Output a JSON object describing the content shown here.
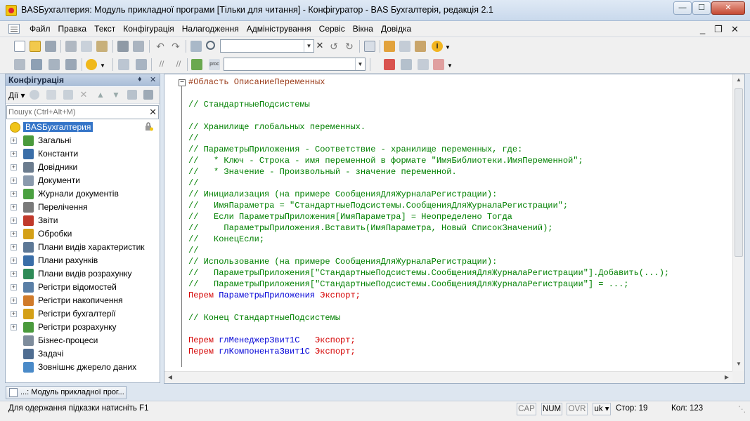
{
  "window": {
    "title": "BASБухгалтерия: Модуль прикладної програми [Тільки для читання] - Конфігуратор - BAS Бухгалтерія, редакція 2.1",
    "minimize_icon": "minimize-icon",
    "maximize_icon": "maximize-icon",
    "close_icon": "close-icon"
  },
  "menu": {
    "items": [
      "Файл",
      "Правка",
      "Текст",
      "Конфігурація",
      "Налагодження",
      "Адміністрування",
      "Сервіс",
      "Вікна",
      "Довідка"
    ]
  },
  "toolbar": {
    "search_value": "",
    "proc_value": ""
  },
  "left_panel": {
    "title": "Конфігурація",
    "actions_label": "Дії",
    "search_placeholder": "Пошук (Ctrl+Alt+M)",
    "root": "BASБухгалтерия",
    "items": [
      {
        "label": "Загальні",
        "icon": "common-icon",
        "color": "#4a9a3c",
        "expandable": true
      },
      {
        "label": "Константи",
        "icon": "constants-icon",
        "color": "#3a6ea8",
        "expandable": true
      },
      {
        "label": "Довідники",
        "icon": "catalogs-icon",
        "color": "#6b7c8e",
        "expandable": true
      },
      {
        "label": "Документи",
        "icon": "documents-icon",
        "color": "#8a9aad",
        "expandable": true
      },
      {
        "label": "Журнали документів",
        "icon": "journals-icon",
        "color": "#4aa040",
        "expandable": true
      },
      {
        "label": "Перелічення",
        "icon": "enums-icon",
        "color": "#7a7a7a",
        "expandable": true
      },
      {
        "label": "Звіти",
        "icon": "reports-icon",
        "color": "#c0392b",
        "expandable": true
      },
      {
        "label": "Обробки",
        "icon": "processing-icon",
        "color": "#d4a017",
        "expandable": true
      },
      {
        "label": "Плани видів характеристик",
        "icon": "char-plans-icon",
        "color": "#5d7896",
        "expandable": true
      },
      {
        "label": "Плани рахунків",
        "icon": "accounts-icon",
        "color": "#3a6ea8",
        "expandable": true
      },
      {
        "label": "Плани видів розрахунку",
        "icon": "calc-plans-icon",
        "color": "#2e8b57",
        "expandable": true
      },
      {
        "label": "Регістри відомостей",
        "icon": "info-registers-icon",
        "color": "#5a7fa6",
        "expandable": true
      },
      {
        "label": "Регістри накопичення",
        "icon": "accum-registers-icon",
        "color": "#d07b2a",
        "expandable": true
      },
      {
        "label": "Регістри бухгалтерії",
        "icon": "acc-registers-icon",
        "color": "#d4a017",
        "expandable": true
      },
      {
        "label": "Регістри розрахунку",
        "icon": "calc-registers-icon",
        "color": "#4a9a3c",
        "expandable": true
      },
      {
        "label": "Бізнес-процеси",
        "icon": "bp-icon",
        "color": "#7e8c9c",
        "expandable": false
      },
      {
        "label": "Задачі",
        "icon": "tasks-icon",
        "color": "#4f6d91",
        "expandable": false
      },
      {
        "label": "Зовнішнє джерело даних",
        "icon": "ext-source-icon",
        "color": "#4a8ac8",
        "expandable": false
      }
    ]
  },
  "editor": {
    "lines": [
      [
        {
          "t": "#Область ОписаниеПеременных",
          "c": "c-directive"
        }
      ],
      [
        {
          "t": "",
          "c": ""
        }
      ],
      [
        {
          "t": "// СтандартныеПодсистемы",
          "c": "c-comment"
        }
      ],
      [
        {
          "t": "",
          "c": ""
        }
      ],
      [
        {
          "t": "// Хранилище глобальных переменных.",
          "c": "c-comment"
        }
      ],
      [
        {
          "t": "//",
          "c": "c-comment"
        }
      ],
      [
        {
          "t": "// ПараметрыПриложения - Соответствие - хранилище переменных, где:",
          "c": "c-comment"
        }
      ],
      [
        {
          "t": "//   * Ключ - Строка - имя переменной в формате \"ИмяБиблиотеки.ИмяПеременной\";",
          "c": "c-comment"
        }
      ],
      [
        {
          "t": "//   * Значение - Произвольный - значение переменной.",
          "c": "c-comment"
        }
      ],
      [
        {
          "t": "//",
          "c": "c-comment"
        }
      ],
      [
        {
          "t": "// Инициализация (на примере СообщенияДляЖурналаРегистрации):",
          "c": "c-comment"
        }
      ],
      [
        {
          "t": "//   ИмяПараметра = \"СтандартныеПодсистемы.СообщенияДляЖурналаРегистрации\";",
          "c": "c-comment"
        }
      ],
      [
        {
          "t": "//   Если ПараметрыПриложения[ИмяПараметра] = Неопределено Тогда",
          "c": "c-comment"
        }
      ],
      [
        {
          "t": "//     ПараметрыПриложения.Вставить(ИмяПараметра, Новый СписокЗначений);",
          "c": "c-comment"
        }
      ],
      [
        {
          "t": "//   КонецЕсли;",
          "c": "c-comment"
        }
      ],
      [
        {
          "t": "//",
          "c": "c-comment"
        }
      ],
      [
        {
          "t": "// Использование (на примере СообщенияДляЖурналаРегистрации):",
          "c": "c-comment"
        }
      ],
      [
        {
          "t": "//   ПараметрыПриложения[\"СтандартныеПодсистемы.СообщенияДляЖурналаРегистрации\"].Добавить(...);",
          "c": "c-comment"
        }
      ],
      [
        {
          "t": "//   ПараметрыПриложения[\"СтандартныеПодсистемы.СообщенияДляЖурналаРегистрации\"] = ...;",
          "c": "c-comment"
        }
      ],
      [
        {
          "t": "Перем ",
          "c": "c-keyword"
        },
        {
          "t": "ПараметрыПриложения ",
          "c": "c-ident"
        },
        {
          "t": "Экспорт;",
          "c": "c-keyword"
        }
      ],
      [
        {
          "t": "",
          "c": ""
        }
      ],
      [
        {
          "t": "// Конец СтандартныеПодсистемы",
          "c": "c-comment"
        }
      ],
      [
        {
          "t": "",
          "c": ""
        }
      ],
      [
        {
          "t": "Перем ",
          "c": "c-keyword"
        },
        {
          "t": "глМенеджерЗвит1С   ",
          "c": "c-ident"
        },
        {
          "t": "Экспорт;",
          "c": "c-keyword"
        }
      ],
      [
        {
          "t": "Перем ",
          "c": "c-keyword"
        },
        {
          "t": "глКомпонентаЗвит1С ",
          "c": "c-ident"
        },
        {
          "t": "Экспорт;",
          "c": "c-keyword"
        }
      ]
    ]
  },
  "bottom": {
    "doc_tab": "...: Модуль прикладної прог...",
    "status_hint": "Для одержання підказки натисніть F1",
    "cap": "CAP",
    "num": "NUM",
    "ovr": "OVR",
    "lang": "uk",
    "row": "Стор: 19",
    "col": "Кол: 123"
  }
}
